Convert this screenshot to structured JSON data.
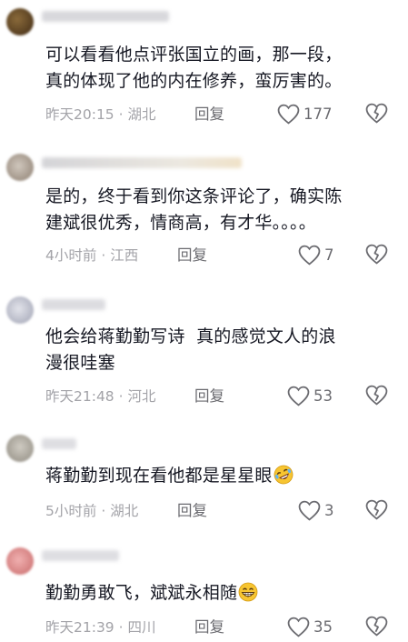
{
  "comments": [
    {
      "text": "可以看看他点评张国立的画，那一段，\n真的体现了他的内在修养，蛮厉害的。",
      "time": "昨天20:15",
      "location": "湖北",
      "reply_label": "回复",
      "likes": "177",
      "avatar_color": "#5a3f22",
      "emoji": ""
    },
    {
      "text": "是的，终于看到你这条评论了，确实陈\n建斌很优秀，情商高，有才华。。。。",
      "time": "4小时前",
      "location": "江西",
      "reply_label": "回复",
      "likes": "7",
      "avatar_color": "#b6a99c",
      "emoji": ""
    },
    {
      "text": "他会给蒋勤勤写诗  真的感觉文人的浪\n漫很哇塞",
      "time": "昨天21:48",
      "location": "河北",
      "reply_label": "回复",
      "likes": "53",
      "avatar_color": "#c6c8d4",
      "emoji": ""
    },
    {
      "text": "蒋勤勤到现在看他都是星星眼",
      "time": "5小时前",
      "location": "湖北",
      "reply_label": "回复",
      "likes": "3",
      "avatar_color": "#b7b3ab",
      "emoji": "rolling-on-floor-laughing-emoji"
    },
    {
      "text": "勤勤勇敢飞，斌斌永相随",
      "time": "昨天21:39",
      "location": "四川",
      "reply_label": "回复",
      "likes": "35",
      "avatar_color": "#d98b8b",
      "emoji": "grinning-emoji"
    }
  ],
  "meta_separator": "·",
  "colors": {
    "text": "#161823",
    "meta": "#a3a3a8",
    "action": "#6b6b70"
  }
}
